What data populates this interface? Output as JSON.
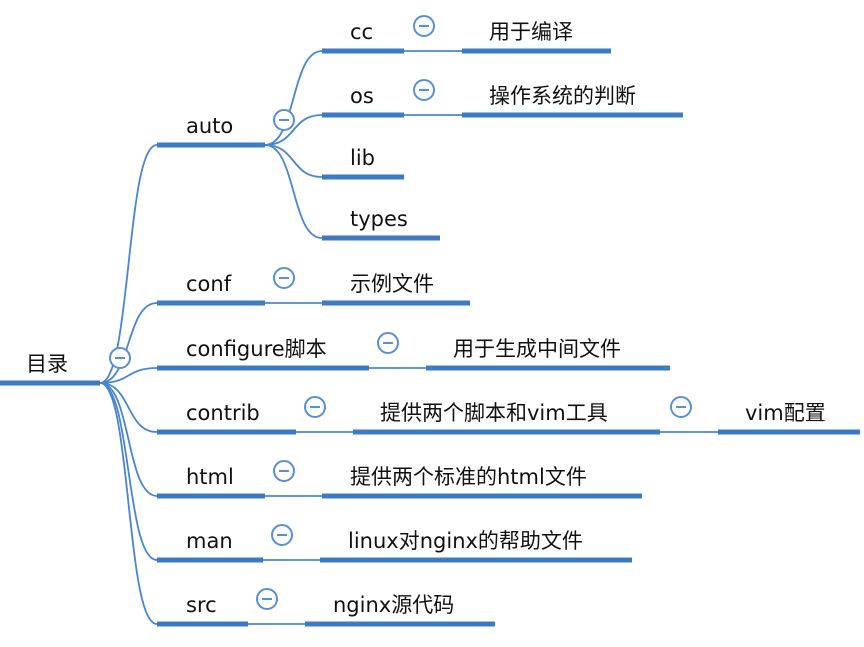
{
  "root": {
    "label": "目录",
    "children": [
      {
        "id": "auto",
        "label": "auto",
        "children": [
          {
            "id": "auto-cc",
            "label": "cc",
            "children": [
              {
                "id": "auto-cc-desc",
                "label": "用于编译"
              }
            ]
          },
          {
            "id": "auto-os",
            "label": "os",
            "children": [
              {
                "id": "auto-os-desc",
                "label": "操作系统的判断"
              }
            ]
          },
          {
            "id": "auto-lib",
            "label": "lib"
          },
          {
            "id": "auto-types",
            "label": "types"
          }
        ]
      },
      {
        "id": "conf",
        "label": "conf",
        "children": [
          {
            "id": "conf-desc",
            "label": "示例文件"
          }
        ]
      },
      {
        "id": "configure",
        "label": "configure脚本",
        "children": [
          {
            "id": "configure-desc",
            "label": "用于生成中间文件"
          }
        ]
      },
      {
        "id": "contrib",
        "label": "contrib",
        "children": [
          {
            "id": "contrib-desc",
            "label": "提供两个脚本和vim工具",
            "children": [
              {
                "id": "contrib-vim",
                "label": "vim配置"
              }
            ]
          }
        ]
      },
      {
        "id": "html",
        "label": "html",
        "children": [
          {
            "id": "html-desc",
            "label": "提供两个标准的html文件"
          }
        ]
      },
      {
        "id": "man",
        "label": "man",
        "children": [
          {
            "id": "man-desc",
            "label": "linux对nginx的帮助文件"
          }
        ]
      },
      {
        "id": "src",
        "label": "src",
        "children": [
          {
            "id": "src-desc",
            "label": "nginx源代码"
          }
        ]
      }
    ]
  },
  "colors": {
    "line": "#4a86d0",
    "bar": "#3e79c3",
    "toggle": "#5b8fd3"
  },
  "toggle_icon": "collapse-minus-icon"
}
